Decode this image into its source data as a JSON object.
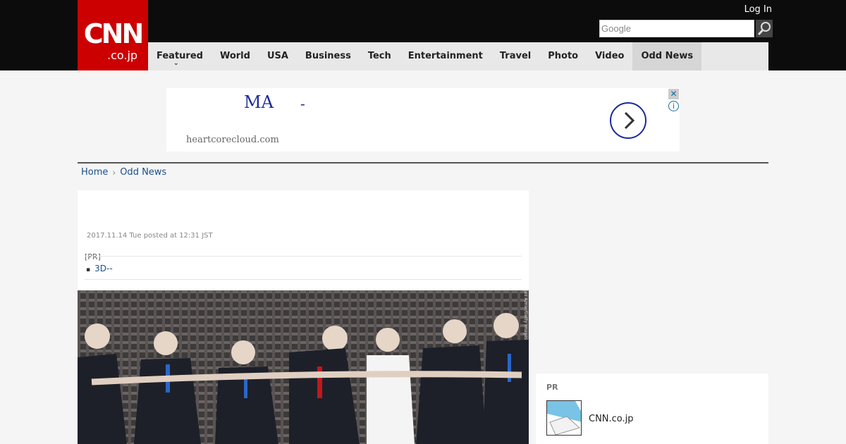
{
  "header": {
    "logo_main": "CNN",
    "logo_sub": ".co.jp",
    "login_label": "Log In",
    "search": {
      "placeholder": "Google"
    }
  },
  "nav": {
    "items": [
      {
        "label": "Featured",
        "has_dropdown": true
      },
      {
        "label": "World"
      },
      {
        "label": "USA"
      },
      {
        "label": "Business"
      },
      {
        "label": "Tech"
      },
      {
        "label": "Entertainment"
      },
      {
        "label": "Travel"
      },
      {
        "label": "Photo"
      },
      {
        "label": "Video"
      },
      {
        "label": "Odd News",
        "active": true
      }
    ]
  },
  "ad": {
    "headline": "MA",
    "dash": "-",
    "domain": "heartcorecloud.com",
    "close_icon": "close-icon",
    "info_icon": "info-icon"
  },
  "breadcrumb": {
    "items": [
      "Home",
      "Odd News"
    ]
  },
  "article": {
    "date": "2017.11.14 Tue posted at 12:31 JST",
    "pr_label": "[PR]",
    "pr_link": "3D--",
    "photo_credit": "Jes Aznar/Getty Images",
    "photo_icon": "photo-image"
  },
  "sidebar": {
    "pr_label": "PR",
    "pr_item_name": "CNN.co.jp"
  },
  "colors": {
    "brand_red": "#cc0000",
    "topbar": "#0c0c0c",
    "nav_bg": "#e8e8e8",
    "link_blue": "#1a4f8a",
    "ad_blue": "#1b2a9a"
  }
}
